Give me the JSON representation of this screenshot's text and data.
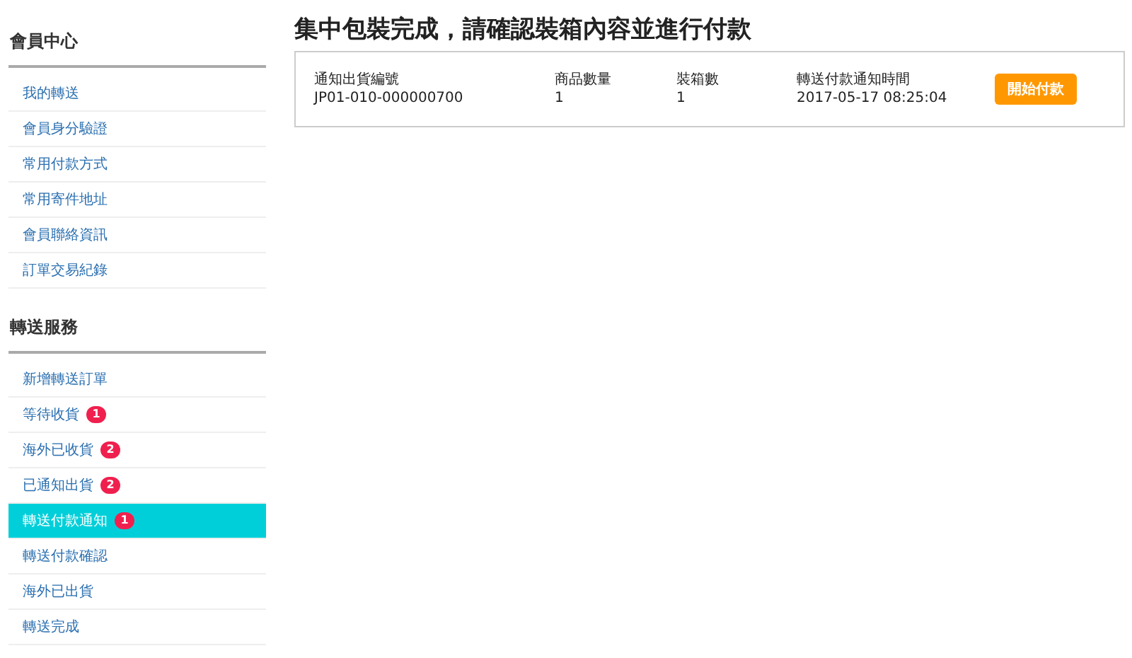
{
  "sidebar": {
    "sections": [
      {
        "title": "會員中心",
        "items": [
          {
            "label": "我的轉送",
            "selected": false
          },
          {
            "label": "會員身分驗證",
            "selected": false
          },
          {
            "label": "常用付款方式",
            "selected": false
          },
          {
            "label": "常用寄件地址",
            "selected": false
          },
          {
            "label": "會員聯絡資訊",
            "selected": false
          },
          {
            "label": "訂單交易紀錄",
            "selected": false
          }
        ]
      },
      {
        "title": "轉送服務",
        "items": [
          {
            "label": "新增轉送訂單",
            "selected": false
          },
          {
            "label": "等待收貨",
            "badge": "1",
            "selected": false
          },
          {
            "label": "海外已收貨",
            "badge": "2",
            "selected": false
          },
          {
            "label": "已通知出貨",
            "badge": "2",
            "selected": false
          },
          {
            "label": "轉送付款通知",
            "badge": "1",
            "selected": true
          },
          {
            "label": "轉送付款確認",
            "selected": false
          },
          {
            "label": "海外已出貨",
            "selected": false
          },
          {
            "label": "轉送完成",
            "selected": false
          }
        ]
      }
    ]
  },
  "main": {
    "title": "集中包裝完成，請確認裝箱內容並進行付款",
    "card": {
      "fields": [
        {
          "label": "通知出貨編號",
          "value": "JP01-010-000000700"
        },
        {
          "label": "商品數量",
          "value": "1"
        },
        {
          "label": "裝箱數",
          "value": "1"
        },
        {
          "label": "轉送付款通知時間",
          "value": "2017-05-17 08:25:04"
        }
      ],
      "button": "開始付款"
    }
  }
}
